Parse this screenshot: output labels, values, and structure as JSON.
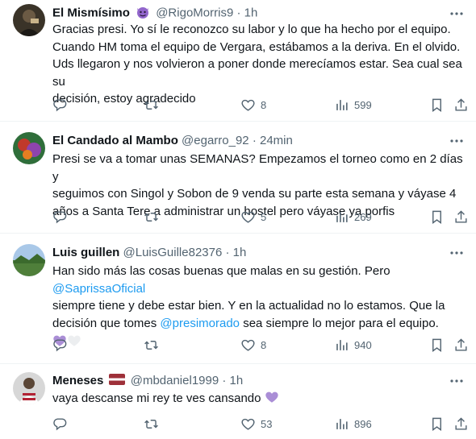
{
  "colors": {
    "link": "#1d9bf0",
    "muted": "#536471",
    "heart_purple": "#aa8ed6"
  },
  "tweets": [
    {
      "name": "El Mismísimo",
      "badge": "devil-emoji",
      "handle": "@RigoMorris9",
      "sep": "·",
      "time": "1h",
      "lines": [
        "Gracias presi. Yo sí le reconozco su labor y lo que ha hecho por el equipo.",
        "Cuando HM toma el equipo de Vergara, estábamos a la deriva. En el olvido.",
        "Uds llegaron y nos volvieron a poner donde merecíamos estar. Sea cual sea su",
        "decisión, estoy agradecido"
      ],
      "likes": "8",
      "views": "599"
    },
    {
      "name": "El Candado al Mambo",
      "handle": "@egarro_92",
      "sep": "·",
      "time": "24min",
      "lines": [
        "Presi se va a tomar unas SEMANAS? Empezamos el torneo como en 2 días y",
        "seguimos con Singol y Sobon de 9 venda su parte esta semana y váyase 4",
        "años a Santa Tere a administrar un hostel pero váyase ya porfis"
      ],
      "likes": "5",
      "views": "269"
    },
    {
      "name": "Luis guillen",
      "handle": "@LuisGuille82376",
      "sep": "·",
      "time": "1h",
      "line1_pre": "Han sido más las cosas buenas que malas en su gestión. Pero ",
      "line1_link": "@SaprissaOficial",
      "line2": "siempre tiene y debe estar bien. Y en la actualidad no lo estamos. Que la",
      "line3_pre": "decisión que tomes ",
      "line3_link": "@presimorado",
      "line3_post": " sea siempre lo mejor para el equipo.",
      "hearts": [
        "purple-heart-emoji",
        "white-heart-emoji"
      ],
      "likes": "8",
      "views": "940"
    },
    {
      "name": "Meneses",
      "badge": "latvia-flag-emoji",
      "handle": "@mbdaniel1999",
      "sep": "·",
      "time": "1h",
      "text": "vaya descanse mi rey  te ves cansando ",
      "heart": "purple-heart-emoji",
      "likes": "53",
      "views": "896"
    }
  ]
}
